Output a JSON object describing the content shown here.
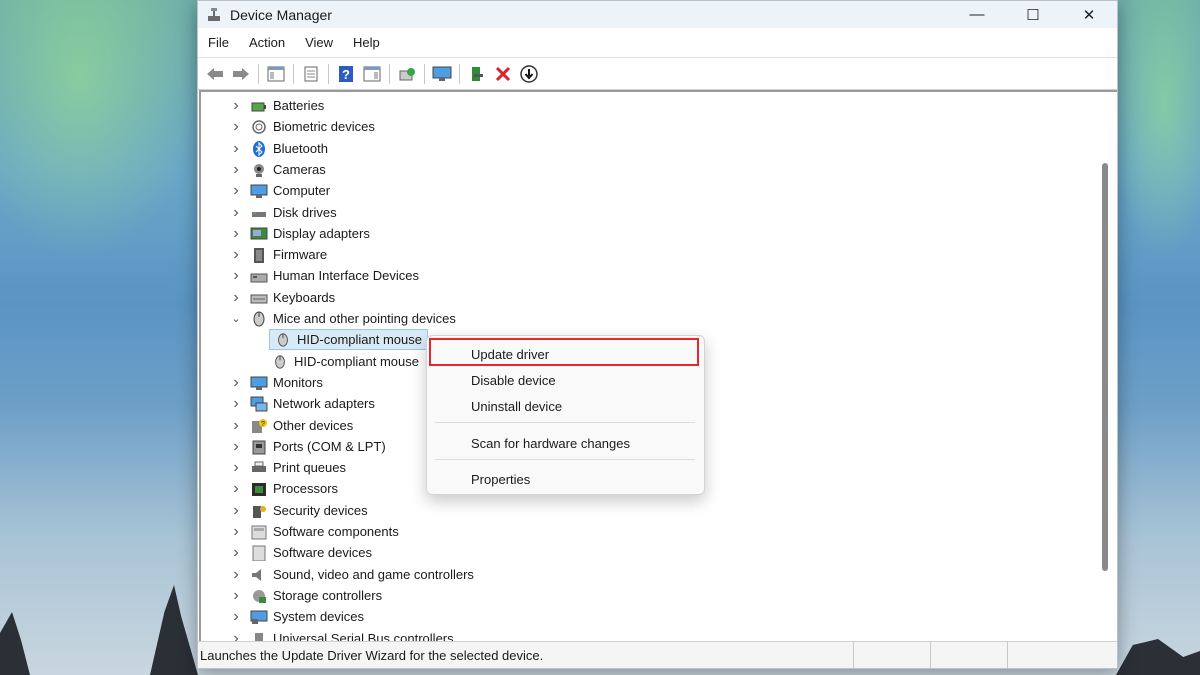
{
  "window": {
    "title": "Device Manager",
    "controls": {
      "minimize": "—",
      "maximize": "☐",
      "close": "✕"
    }
  },
  "menu": [
    "File",
    "Action",
    "View",
    "Help"
  ],
  "toolbar": {
    "icons": [
      "back-arrow-icon",
      "forward-arrow-icon",
      "show-hide-console-tree-icon",
      "properties-icon",
      "help-icon",
      "action-pane-icon",
      "scan-hardware-icon",
      "monitor-icon",
      "update-driver-icon",
      "uninstall-icon",
      "disable-icon"
    ]
  },
  "tree": {
    "categories": [
      {
        "label": "Batteries",
        "icon": "battery-icon"
      },
      {
        "label": "Biometric devices",
        "icon": "fingerprint-icon"
      },
      {
        "label": "Bluetooth",
        "icon": "bluetooth-icon"
      },
      {
        "label": "Cameras",
        "icon": "camera-icon"
      },
      {
        "label": "Computer",
        "icon": "computer-icon"
      },
      {
        "label": "Disk drives",
        "icon": "disk-drive-icon"
      },
      {
        "label": "Display adapters",
        "icon": "display-adapter-icon"
      },
      {
        "label": "Firmware",
        "icon": "firmware-icon"
      },
      {
        "label": "Human Interface Devices",
        "icon": "hid-icon"
      },
      {
        "label": "Keyboards",
        "icon": "keyboard-icon"
      },
      {
        "label": "Mice and other pointing devices",
        "icon": "mouse-icon",
        "expanded": true,
        "children": [
          {
            "label": "HID-compliant mouse",
            "selected": true
          },
          {
            "label": "HID-compliant mouse"
          }
        ]
      },
      {
        "label": "Monitors",
        "icon": "monitor-icon"
      },
      {
        "label": "Network adapters",
        "icon": "network-icon"
      },
      {
        "label": "Other devices",
        "icon": "unknown-device-icon"
      },
      {
        "label": "Ports (COM & LPT)",
        "icon": "port-icon"
      },
      {
        "label": "Print queues",
        "icon": "printer-icon"
      },
      {
        "label": "Processors",
        "icon": "processor-icon"
      },
      {
        "label": "Security devices",
        "icon": "security-key-icon"
      },
      {
        "label": "Software components",
        "icon": "software-component-icon"
      },
      {
        "label": "Software devices",
        "icon": "software-device-icon"
      },
      {
        "label": "Sound, video and game controllers",
        "icon": "speaker-icon"
      },
      {
        "label": "Storage controllers",
        "icon": "storage-controller-icon"
      },
      {
        "label": "System devices",
        "icon": "system-devices-icon"
      },
      {
        "label": "Universal Serial Bus controllers",
        "icon": "usb-icon"
      }
    ]
  },
  "context_menu": {
    "items": [
      "Update driver",
      "Disable device",
      "Uninstall device",
      "Scan for hardware changes",
      "Properties"
    ],
    "highlighted": "Update driver",
    "highlight_color": "#e0282e"
  },
  "status": {
    "message": "Launches the Update Driver Wizard for the selected device."
  }
}
